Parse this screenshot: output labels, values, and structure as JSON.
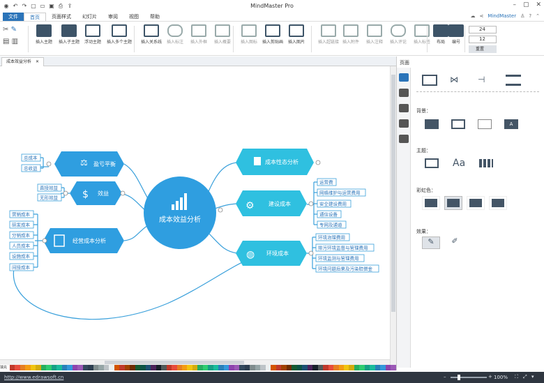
{
  "app_title": "MindMaster Pro",
  "menu": {
    "file": "文件",
    "tabs": [
      "首页",
      "页面样式",
      "幻灯片",
      "审阅",
      "视图",
      "帮助"
    ],
    "brand": "MindMaster"
  },
  "ribbon": {
    "buttons": [
      {
        "label": "插入主题",
        "icon": "insert-topic-icon"
      },
      {
        "label": "插入子主题",
        "icon": "insert-subtopic-icon"
      },
      {
        "label": "浮动主题",
        "icon": "floating-topic-icon"
      },
      {
        "label": "插入多个主题",
        "icon": "multiple-topics-icon"
      },
      {
        "label": "插入关系线",
        "icon": "relationship-icon"
      },
      {
        "label": "插入标注",
        "icon": "callout-icon"
      },
      {
        "label": "插入外框",
        "icon": "boundary-icon"
      },
      {
        "label": "插入概要",
        "icon": "summary-icon"
      },
      {
        "label": "插入图标",
        "icon": "icon-icon"
      },
      {
        "label": "插入剪贴画",
        "icon": "clipart-icon"
      },
      {
        "label": "插入图片",
        "icon": "image-icon"
      },
      {
        "label": "插入超链接",
        "icon": "hyperlink-icon"
      },
      {
        "label": "插入附件",
        "icon": "attachment-icon"
      },
      {
        "label": "插入注释",
        "icon": "note-icon"
      },
      {
        "label": "插入评论",
        "icon": "comment-icon"
      },
      {
        "label": "插入标签",
        "icon": "tag-icon"
      },
      {
        "label": "布局",
        "icon": "layout-icon"
      },
      {
        "label": "编号",
        "icon": "numbering-icon"
      }
    ],
    "font_size_1": "24",
    "font_size_2": "12",
    "reset_label": "重置"
  },
  "doc_tab": "成本效益分析",
  "mindmap": {
    "central": "成本效益分析",
    "branches": [
      {
        "label": "盈亏平衡",
        "subs": [
          "总成本",
          "总收益"
        ]
      },
      {
        "label": "效益",
        "subs": [
          "直接效益",
          "无形效益"
        ]
      },
      {
        "label": "经营成本分析",
        "subs": [
          "营销成本",
          "研发成本",
          "分销成本",
          "人员成本",
          "设施成本",
          "间接成本"
        ]
      },
      {
        "label": "成本性态分析",
        "subs": []
      },
      {
        "label": "建设成本",
        "subs": [
          "运营费",
          "网络维护与运营费用",
          "安全建设费用",
          "通信设备",
          "专网及通道"
        ]
      },
      {
        "label": "环境成本",
        "subs": [
          "环境治理费用",
          "排污环境监督与管理费用",
          "环境监测与管理费用",
          "环境问题后果及污染赔偿金"
        ]
      }
    ]
  },
  "panel": {
    "title": "页面",
    "sec_background": "背景：",
    "sec_theme": "主题：",
    "sec_colors": "彩虹色：",
    "sec_effects": "效果："
  },
  "colors": {
    "accent": "#2b74b9",
    "node_blue": "#2f9ee0",
    "node_cyan": "#2fc0e0",
    "central": "#2f9ee0"
  },
  "status": {
    "url": "http://www.edrawsoft.cn",
    "zoom": "100%",
    "palette_label": "填充"
  }
}
